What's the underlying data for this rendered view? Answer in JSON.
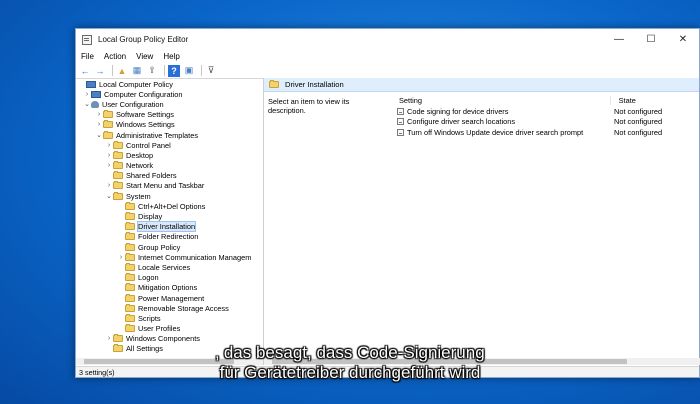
{
  "window": {
    "title": "Local Group Policy Editor",
    "minimize": "—",
    "maximize": "☐",
    "close": "✕"
  },
  "menu": [
    "File",
    "Action",
    "View",
    "Help"
  ],
  "toolbar": {
    "back": "←",
    "forward": "→",
    "up": "▲",
    "show_hide": "▦",
    "export": "⇪",
    "help": "?",
    "properties": "▣",
    "filter": "⊽"
  },
  "tree": [
    {
      "label": "Local Computer Policy",
      "chev": "",
      "icon": "pc"
    },
    {
      "label": "Computer Configuration",
      "chev": "›",
      "icon": "pc"
    },
    {
      "label": "User Configuration",
      "chev": "⌄",
      "icon": "user"
    },
    {
      "label": "Software Settings",
      "chev": "›",
      "icon": "folder"
    },
    {
      "label": "Windows Settings",
      "chev": "›",
      "icon": "folder"
    },
    {
      "label": "Administrative Templates",
      "chev": "⌄",
      "icon": "folder"
    },
    {
      "label": "Control Panel",
      "chev": "›",
      "icon": "folder"
    },
    {
      "label": "Desktop",
      "chev": "›",
      "icon": "folder"
    },
    {
      "label": "Network",
      "chev": "›",
      "icon": "folder"
    },
    {
      "label": "Shared Folders",
      "chev": "",
      "icon": "folder"
    },
    {
      "label": "Start Menu and Taskbar",
      "chev": "›",
      "icon": "folder"
    },
    {
      "label": "System",
      "chev": "⌄",
      "icon": "folder"
    },
    {
      "label": "Ctrl+Alt+Del Options",
      "chev": "",
      "icon": "folder"
    },
    {
      "label": "Display",
      "chev": "",
      "icon": "folder"
    },
    {
      "label": "Driver Installation",
      "chev": "",
      "icon": "folder",
      "selected": true
    },
    {
      "label": "Folder Redirection",
      "chev": "",
      "icon": "folder"
    },
    {
      "label": "Group Policy",
      "chev": "",
      "icon": "folder"
    },
    {
      "label": "Internet Communication Managem",
      "chev": "›",
      "icon": "folder"
    },
    {
      "label": "Locale Services",
      "chev": "",
      "icon": "folder"
    },
    {
      "label": "Logon",
      "chev": "",
      "icon": "folder"
    },
    {
      "label": "Mitigation Options",
      "chev": "",
      "icon": "folder"
    },
    {
      "label": "Power Management",
      "chev": "",
      "icon": "folder"
    },
    {
      "label": "Removable Storage Access",
      "chev": "",
      "icon": "folder"
    },
    {
      "label": "Scripts",
      "chev": "",
      "icon": "folder"
    },
    {
      "label": "User Profiles",
      "chev": "",
      "icon": "folder"
    },
    {
      "label": "Windows Components",
      "chev": "›",
      "icon": "folder"
    },
    {
      "label": "All Settings",
      "chev": "",
      "icon": "folder"
    }
  ],
  "right": {
    "header_title": "Driver Installation",
    "description": "Select an item to view its description.",
    "col_setting": "Setting",
    "col_state": "State",
    "rows": [
      {
        "setting": "Code signing for device drivers",
        "state": "Not configured"
      },
      {
        "setting": "Configure driver search locations",
        "state": "Not configured"
      },
      {
        "setting": "Turn off Windows Update device driver search prompt",
        "state": "Not configured"
      }
    ]
  },
  "status": "3 setting(s)",
  "subtitles": [
    "‚ das besagt, dass Code-Signierung",
    "für Gerätetreiber durchgeführt wird"
  ]
}
